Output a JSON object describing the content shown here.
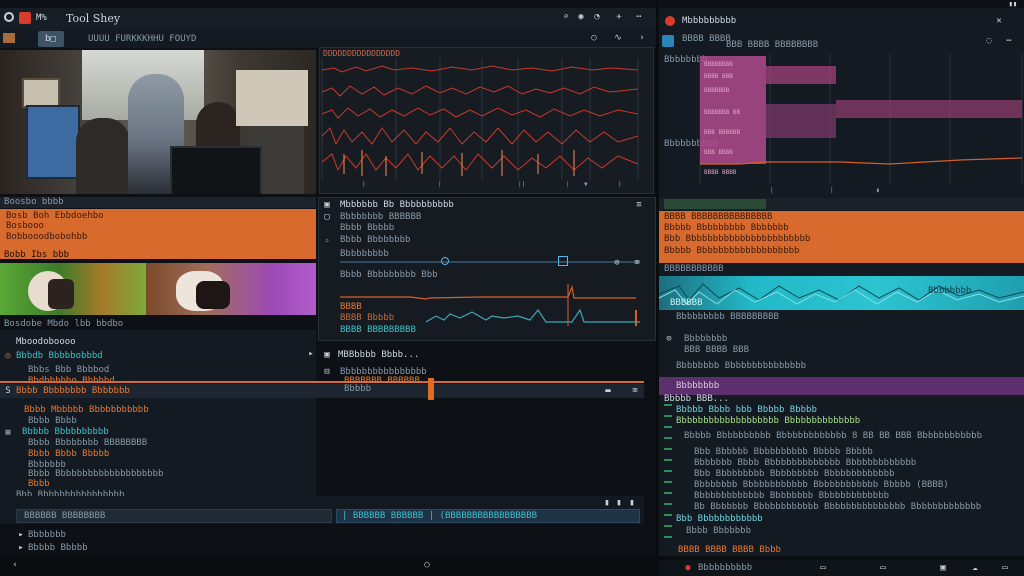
{
  "colors": {
    "accent_orange": "#e8762f",
    "accent_teal": "#22b8c8",
    "accent_purple": "#7b3a8c",
    "panel": "#141a21",
    "bg": "#0d1116",
    "record_red": "#d83a2b"
  },
  "window": {
    "title": "Tool Shey",
    "menu_label": "M%"
  },
  "toolbar": {
    "path": "UUUU FURKKKHHU FOUYD"
  },
  "waveform_panel": {
    "title": "DDDDDDDDDDDDDDDD"
  },
  "left_orange": {
    "header": "Boosbo bbbb",
    "rows": [
      "Bosb Boh Ebbdoehbo",
      "Bosbooo",
      "Bobbooodbobohbb"
    ],
    "footer": "Bobb Ibs bbb"
  },
  "thumbs_caption": "Bosdobe Mbdo lbb bbdbo",
  "left_tree": {
    "title": "Mboodoboooo",
    "group1": "Bbbdb Bbbbbobbbd",
    "items1": [
      "Bbbs Bbb Bbbbod",
      "Bbdbbbbbo Bbbbbd",
      "Bbbb Mbbbbb Bbbbbbbbbbb",
      "Bbbb Bbbb",
      "Bbbbb Bbbbbbbbbb",
      "Bbbb Bbbbbbbb BBBBBBBB",
      "Bbbb Bbbb Bbbbb",
      "Bbbbbbb",
      "Bbbb Bbbbbbbbbbbbbbbbbbbb",
      "Bbbb"
    ],
    "group2": "Bbb Bbbbbbbbbbbbbbbb",
    "selected_row": "Bbbb Bbbbbbbb Bbbbbbb",
    "footer_items": [
      "Bbbbbbb",
      "Bbbbb Bbbbb"
    ]
  },
  "middle_props": {
    "title": "Mbbbbbb Bb Bbbbbbbbbb",
    "rows": [
      "Bbbbbbbb BBBBBB",
      "Bbbb Bbbbb",
      "Bbbb Bbbbbbbb"
    ],
    "row_label": "Bbbbbbbbb",
    "slider_label": "Bbbb Bbbbbbbbb Bbb",
    "fields": [
      "BBBB",
      "BBBB Bbbbb",
      "BBBB BBBBBBBBB"
    ]
  },
  "middle_lower": {
    "title": "MBBbbbb Bbbb...",
    "sub": [
      "Bbbbbbbbbbbbbbbb",
      "BBBBBBB BBBBBB",
      "Bbbbb"
    ]
  },
  "bottom_input": {
    "value": "BBBBBB BBBBBBBB",
    "search": "| BBBBBB BBBBBB | (BBBBBBBBBBBBBBBBB"
  },
  "right_panel": {
    "title": "Mbbbbbbbbb",
    "subtitle": "BBBB BBBB",
    "subtitle2": "BBB BBBB BBBBBBBB",
    "labels": [
      "Bbbbbbbb",
      "Bbbbbbbbbb"
    ],
    "orange_rows": [
      "BBBB BBBBBBBBBBBBBBB",
      "Bbbbb Bbbbbbbbb Bbbbbbb",
      "Bbb Bbbbbbbbbbbbbbbbbbbbbbb",
      "Bbbbb Bbbbbbbbbbbbbbbbbbb"
    ],
    "teal_header": "BBBBBBBBBBB",
    "teal_overlay": "BBBBBB",
    "teal_tail": "Bbbbbbbb",
    "below_teal": [
      "Bbbbbbbbb BBBBBBBBB",
      "Bbbbbbbb",
      "BBB BBBB BBB",
      "Bbbbbbbb Bbbbbbbbbbbbbbb"
    ],
    "purple_row": "Bbbbbbbb",
    "log_header": "Bbbbb BBB...",
    "log_rows": [
      "Bbbbb Bbbb bbb Bbbbb Bbbbb",
      "Bbbbbbbbbbbbbbbbbbb Bbbbbbbbbbbbbb",
      "Bbbbb Bbbbbbbbbb Bbbbbbbbbbbbb 8 BB BB BBB Bbbbbbbbbbbb",
      "Bbb Bbbbbb Bbbbbbbbbb Bbbbb Bbbbb",
      "Bbbbbbb Bbbb Bbbbbbbbbbbbbb Bbbbbbbbbbbbb",
      "Bbb Bbbbbbbbb Bbbbbbbbb Bbbbbbbbbbbbb",
      "Bbbbbbbb Bbbbbbbbbbbb Bbbbbbbbbbbb Bbbbb (BBBB)",
      "Bbbbbbbbbbbbb Bbbbbbbb Bbbbbbbbbbbbb",
      "Bb Bbbbbbb Bbbbbbbbbbbb Bbbbbbbbbbbbbbb Bbbbbbbbbbbbb",
      "Bbb Bbbbbbbbbbbb",
      "Bbbb Bbbbbbb",
      "BBBB BBBB BBBB Bbbb"
    ],
    "status": "Bbbbbbbbbb"
  }
}
